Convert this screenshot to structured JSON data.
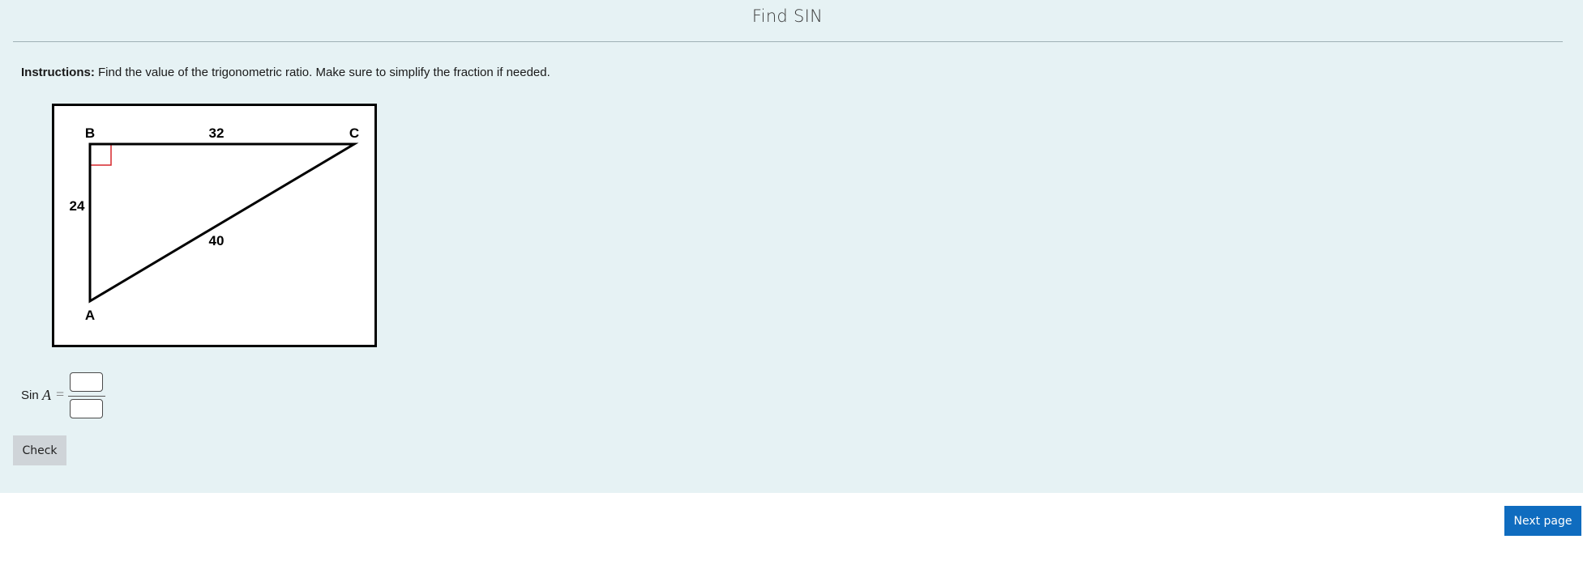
{
  "page": {
    "title": "Find SIN"
  },
  "instructions": {
    "label": "Instructions:",
    "text": " Find the value of the trigonometric ratio. Make sure to simplify the fraction if needed."
  },
  "figure": {
    "vertices": {
      "a": "A",
      "b": "B",
      "c": "C"
    },
    "sides": {
      "bc": "32",
      "ab": "24",
      "ac": "40"
    },
    "right_angle_color": "#d6262b"
  },
  "answer": {
    "prefix": "Sin",
    "variable": "A",
    "equals": "=",
    "numerator_value": "",
    "denominator_value": ""
  },
  "buttons": {
    "check": "Check",
    "next": "Next page"
  },
  "colors": {
    "panel_background": "#e6f2f4",
    "primary_button": "#0f6cbf",
    "secondary_button": "#cfd4d8"
  }
}
